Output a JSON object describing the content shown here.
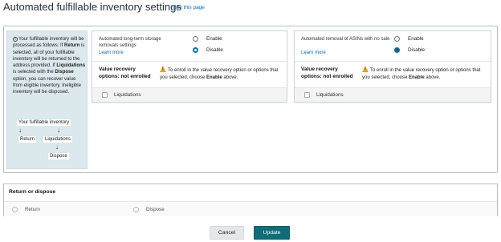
{
  "header": {
    "title": "Automated fulfillable inventory settings",
    "rate_link": "Rate this page"
  },
  "info": {
    "icon": "info-icon",
    "text_part1": "Your fulfillable inventory will be processed as follows: If ",
    "return_word": "Return",
    "text_part2": " is selected, all of your fulfillable inventory will be returned to the address provided. If ",
    "liquidations_word": "Liquidations",
    "text_part3": " is selected with the ",
    "dispose_word": "Dispose",
    "text_part4": " option, you can recover value from eligible inventory. Ineligible inventory will be disposed.",
    "flow": {
      "top": "Your fulfillable inventory",
      "left": "Return",
      "middle": "Liquidations",
      "bottom": "Dispose"
    }
  },
  "storage_card": {
    "description": "Automated long-term storage removals settings",
    "learn_more": "Learn more",
    "enable_label": "Enable",
    "disable_label": "Disable",
    "selected": "Disable",
    "value_recovery_label": "Value recovery options: not enrolled",
    "warning_part1": "To enroll in the value recovery option or options that you selected, choose ",
    "warning_enable": "Enable",
    "warning_part2": " above.",
    "liquidations_label": "Liquidations"
  },
  "asin_card": {
    "description": "Automated removal of ASINs with no sale",
    "learn_more": "Learn more",
    "enable_label": "Enable",
    "disable_label": "Disable",
    "selected": "Disable",
    "value_recovery_label": "Value recovery options: not enrolled",
    "warning_part1": "To enroll in the value recovery option or options that you selected, choose ",
    "warning_enable": "Enable",
    "warning_part2": " above.",
    "liquidations_label": "Liquidations"
  },
  "return_dispose": {
    "title": "Return or dispose",
    "return_label": "Return",
    "dispose_label": "Dispose"
  },
  "footer": {
    "cancel_label": "Cancel",
    "update_label": "Update"
  },
  "colors": {
    "link": "#0066c0",
    "update_button": "#0e6d79",
    "info_background": "#dbe8ec",
    "warning": "#e7a30d"
  }
}
